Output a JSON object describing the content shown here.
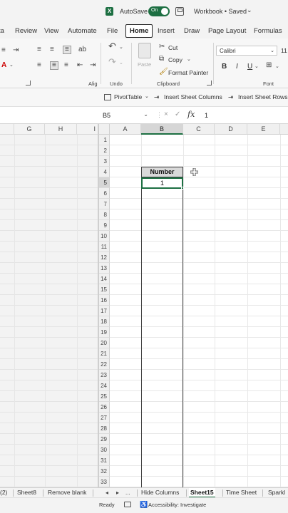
{
  "titlebar": {
    "logo": "X",
    "autosave_label": "AutoSave",
    "toggle_state": "On",
    "workbook_title": "Workbook • Saved",
    "title_chevron": "⌄",
    "icons": [
      "excel-logo",
      "save-icon"
    ]
  },
  "tabs": [
    {
      "label": "ta"
    },
    {
      "label": "Review"
    },
    {
      "label": "View"
    },
    {
      "label": "Automate"
    },
    {
      "label": "File"
    },
    {
      "label": "Home"
    },
    {
      "label": "Insert"
    },
    {
      "label": "Draw"
    },
    {
      "label": "Page Layout"
    },
    {
      "label": "Formulas"
    }
  ],
  "ribbon": {
    "undo_label": "Undo",
    "clipboard_label": "Clipboard",
    "font_label": "Font",
    "alignment_label": "Alig",
    "cut_label": "Cut",
    "copy_label": "Copy",
    "format_painter_label": "Format Painter",
    "paste_label": "Paste",
    "font_name": "Calibri",
    "font_size": "11",
    "bold": "B",
    "italic": "I",
    "underline": "U"
  },
  "quickbar": {
    "pivottable_label": "PivotTable",
    "insert_columns_label": "Insert Sheet Columns",
    "insert_rows_label": "Insert Sheet Rows"
  },
  "formula_bar": {
    "name_box": "B5",
    "fx_symbol": "fx",
    "cancel_symbol": "×",
    "enter_symbol": "✓",
    "separator": "⋮",
    "value": "1"
  },
  "grid": {
    "left_columns": [
      "G",
      "H",
      "I"
    ],
    "columns": [
      "A",
      "B",
      "C",
      "D",
      "E"
    ],
    "selected_column": "B",
    "rows": [
      "1",
      "2",
      "3",
      "4",
      "5",
      "6",
      "7",
      "8",
      "9",
      "10",
      "11",
      "12",
      "13",
      "14",
      "15",
      "16",
      "17",
      "18",
      "19",
      "20",
      "21",
      "22",
      "23",
      "24",
      "25",
      "26",
      "27",
      "28",
      "29",
      "30",
      "31",
      "32",
      "33"
    ],
    "selected_row": "5",
    "header_cell": "Number",
    "active_cell_value": "1"
  },
  "sheet_tabs": {
    "tabs": [
      {
        "label": "(2)"
      },
      {
        "label": "Sheet8"
      },
      {
        "label": "Remove blank"
      },
      {
        "label": "Hide Columns"
      },
      {
        "label": "Sheet15"
      },
      {
        "label": "Time Sheet"
      },
      {
        "label": "Sparkl"
      }
    ],
    "active": "Sheet15",
    "nav_prev": "◂",
    "nav_next": "▸",
    "nav_more": "..."
  },
  "statusbar": {
    "ready": "Ready",
    "accessibility": "Accessibility: Investigate"
  },
  "colors": {
    "accent": "#1d6f42",
    "selected_header": "#d6d6d6"
  }
}
